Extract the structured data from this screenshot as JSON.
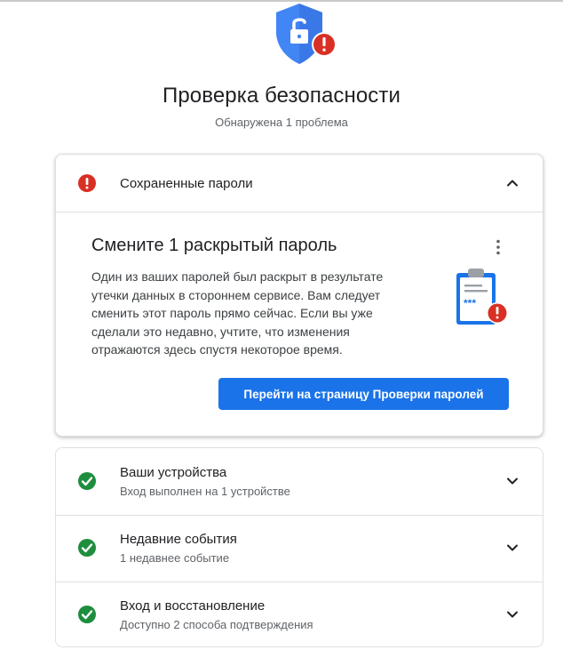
{
  "header": {
    "title": "Проверка безопасности",
    "subtitle": "Обнаружена 1 проблема",
    "icon": "shield-lock-alert-icon"
  },
  "passwords_card": {
    "label": "Сохраненные пароли",
    "status_icon": "error-icon",
    "status_color": "#d93025",
    "expanded": true,
    "issue": {
      "title": "Смените 1 раскрытый пароль",
      "body": "Один из ваших паролей был раскрыт в результате утечки данных в стороннем сервисе. Вам следует сменить этот пароль прямо сейчас. Если вы уже сделали это недавно, учтите, что изменения отражаются здесь спустя некоторое время.",
      "illustration": "clipboard-password-alert-icon",
      "action_label": "Перейти на страницу Проверки паролей"
    }
  },
  "sections": [
    {
      "title": "Ваши устройства",
      "subtitle": "Вход выполнен на 1 устройстве",
      "status_icon": "check-circle-icon"
    },
    {
      "title": "Недавние события",
      "subtitle": "1 недавнее событие",
      "status_icon": "check-circle-icon"
    },
    {
      "title": "Вход и восстановление",
      "subtitle": "Доступно 2 способа подтверждения",
      "status_icon": "check-circle-icon"
    }
  ],
  "colors": {
    "accent": "#1a73e8",
    "error": "#d93025",
    "success": "#1e8e3e"
  }
}
